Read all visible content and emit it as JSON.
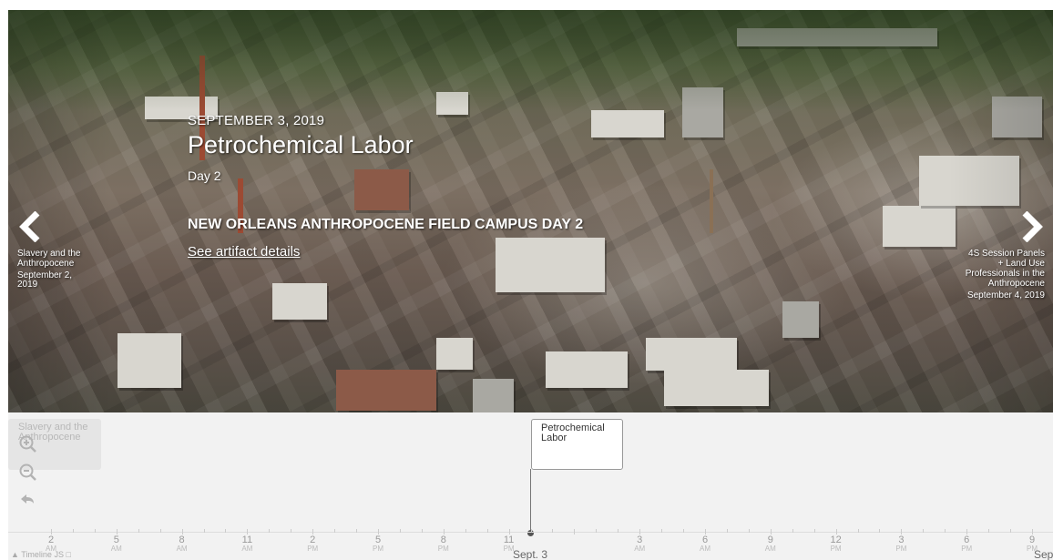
{
  "slide": {
    "date": "SEPTEMBER 3, 2019",
    "title": "Petrochemical Labor",
    "subtitle": "Day 2",
    "headline": "NEW ORLEANS ANTHROPOCENE FIELD CAMPUS DAY 2",
    "link": "See artifact details"
  },
  "nav": {
    "prev": {
      "icon": "chevron-left-icon",
      "label": "Slavery and the Anthropocene",
      "date": "September 2, 2019"
    },
    "next": {
      "icon": "chevron-right-icon",
      "label": "4S Session Panels + Land Use Professionals in the Anthropocene",
      "date": "September 4, 2019"
    }
  },
  "timeline": {
    "markers": {
      "prev": "Slavery and the Anthropocene",
      "active": "Petrochemical Labor"
    },
    "controls": {
      "zoom_in": "zoom-in-icon",
      "zoom_out": "zoom-out-icon",
      "back": "back-to-start-icon"
    },
    "ticks": [
      {
        "num": "2",
        "ampm": "AM"
      },
      {
        "num": "5",
        "ampm": "AM"
      },
      {
        "num": "8",
        "ampm": "AM"
      },
      {
        "num": "11",
        "ampm": "AM"
      },
      {
        "num": "2",
        "ampm": "PM"
      },
      {
        "num": "5",
        "ampm": "PM"
      },
      {
        "num": "8",
        "ampm": "PM"
      },
      {
        "num": "11",
        "ampm": "PM"
      },
      {
        "num": "",
        "ampm": ""
      },
      {
        "num": "3",
        "ampm": "AM"
      },
      {
        "num": "6",
        "ampm": "AM"
      },
      {
        "num": "9",
        "ampm": "AM"
      },
      {
        "num": "12",
        "ampm": "PM"
      },
      {
        "num": "3",
        "ampm": "PM"
      },
      {
        "num": "6",
        "ampm": "PM"
      },
      {
        "num": "9",
        "ampm": "PM"
      }
    ],
    "day_labels": [
      "Sept. 3",
      "Sep"
    ],
    "attribution": "Timeline JS"
  },
  "colors": {
    "timenav_bg": "#f2f2f2",
    "marker_active_bg": "#ffffff",
    "marker_prev_bg": "#e5e5e5"
  }
}
